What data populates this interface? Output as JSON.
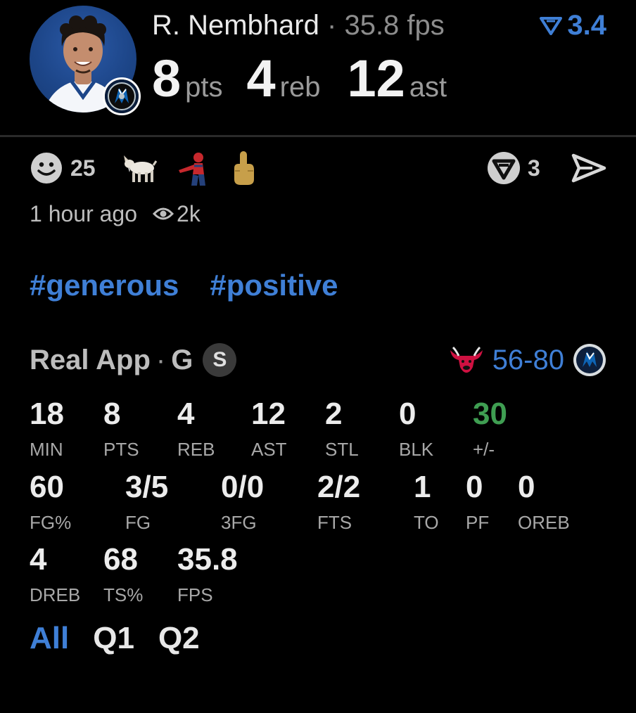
{
  "player": {
    "name": "R. Nembhard",
    "separator": "·",
    "fps_text": "35.8 fps",
    "rating": "3.4",
    "headline": [
      {
        "value": "8",
        "unit": "pts"
      },
      {
        "value": "4",
        "unit": "reb"
      },
      {
        "value": "12",
        "unit": "ast"
      }
    ]
  },
  "reactions": {
    "smile_count": "25",
    "comment_count": "3",
    "items": [
      "smile-icon",
      "goat-icon",
      "spiderman-pointing-icon",
      "middle-finger-icon"
    ]
  },
  "meta": {
    "time": "1 hour ago",
    "views": "2k"
  },
  "tags": [
    "#generous",
    "#positive"
  ],
  "game": {
    "source": "Real App",
    "dot": "·",
    "position": "G",
    "badge": "S",
    "score": "56-80"
  },
  "stats": [
    {
      "label": "MIN",
      "value": "18"
    },
    {
      "label": "PTS",
      "value": "8"
    },
    {
      "label": "REB",
      "value": "4"
    },
    {
      "label": "AST",
      "value": "12"
    },
    {
      "label": "STL",
      "value": "2"
    },
    {
      "label": "BLK",
      "value": "0"
    },
    {
      "label": "+/-",
      "value": "30"
    },
    {
      "label": "FG%",
      "value": "60"
    },
    {
      "label": "FG",
      "value": "3/5"
    },
    {
      "label": "3FG",
      "value": "0/0"
    },
    {
      "label": "FTS",
      "value": "2/2"
    },
    {
      "label": "TO",
      "value": "1"
    },
    {
      "label": "PF",
      "value": "0"
    },
    {
      "label": "OREB",
      "value": "0"
    },
    {
      "label": "DREB",
      "value": "4"
    },
    {
      "label": "TS%",
      "value": "68"
    },
    {
      "label": "FPS",
      "value": "35.8"
    }
  ],
  "tabs": [
    "All",
    "Q1",
    "Q2"
  ],
  "colors": {
    "accent": "#3f7fd6",
    "positive": "#3f9e52",
    "background": "#000000"
  }
}
